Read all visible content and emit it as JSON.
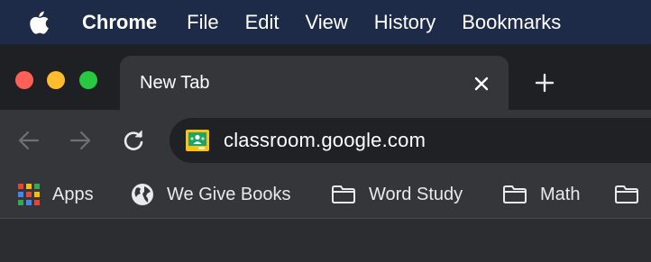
{
  "menubar": {
    "apple_icon": "apple-icon",
    "items": [
      "Chrome",
      "File",
      "Edit",
      "View",
      "History",
      "Bookmarks"
    ]
  },
  "tab": {
    "title": "New Tab",
    "close_icon": "close-icon",
    "new_tab_icon": "plus-icon"
  },
  "toolbar": {
    "back_icon": "arrow-left-icon",
    "forward_icon": "arrow-right-icon",
    "reload_icon": "reload-icon",
    "url": "classroom.google.com",
    "site_icon": "google-classroom-icon"
  },
  "bookmarks": [
    {
      "label": "Apps",
      "icon": "apps-grid-icon"
    },
    {
      "label": "We Give Books",
      "icon": "globe-icon"
    },
    {
      "label": "Word Study",
      "icon": "folder-icon"
    },
    {
      "label": "Math",
      "icon": "folder-icon"
    },
    {
      "label": "",
      "icon": "folder-icon"
    }
  ],
  "colors": {
    "menubar_bg": "#1e2b48",
    "tabstrip_bg": "#1f2023",
    "toolbar_bg": "#35363a",
    "omnibox_bg": "#202124",
    "traffic_red": "#fe5f57",
    "traffic_yellow": "#febc2e",
    "traffic_green": "#28c840"
  }
}
